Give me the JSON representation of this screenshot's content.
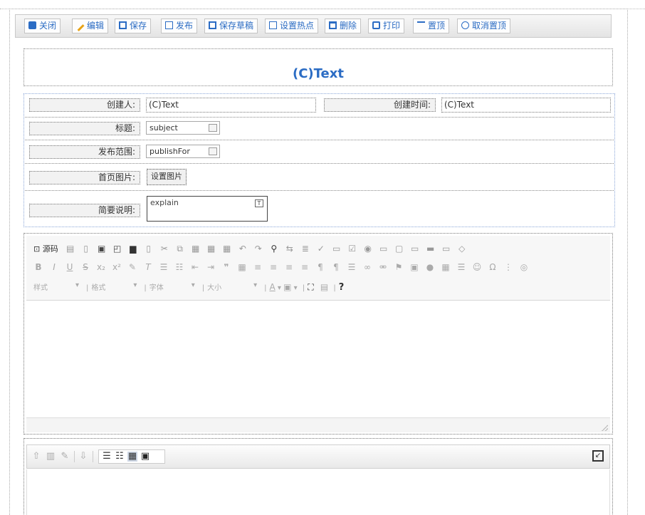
{
  "toolbar": {
    "buttons": [
      {
        "label": "关闭",
        "icon": "close-icon",
        "color": "#2b6cc4"
      },
      {
        "label": "编辑",
        "icon": "pencil-icon",
        "color": "#e8a317"
      },
      {
        "label": "保存",
        "icon": "save-icon",
        "color": "#2b6cc4"
      },
      {
        "label": "发布",
        "icon": "publish-icon",
        "color": "#2b6cc4"
      },
      {
        "label": "保存草稿",
        "icon": "save-draft-icon",
        "color": "#2b6cc4"
      },
      {
        "label": "设置热点",
        "icon": "hotspot-icon",
        "color": "#2b6cc4"
      },
      {
        "label": "删除",
        "icon": "trash-icon",
        "color": "#2b6cc4"
      },
      {
        "label": "打印",
        "icon": "print-icon",
        "color": "#2b6cc4"
      },
      {
        "label": "置顶",
        "icon": "pin-top-icon",
        "color": "#2b6cc4"
      },
      {
        "label": "取消置顶",
        "icon": "unpin-icon",
        "color": "#2b6cc4"
      }
    ]
  },
  "page": {
    "title": "(C)Text",
    "accent": "#2b6cc4"
  },
  "form": {
    "creator_label": "创建人:",
    "creator_value": "(C)Text",
    "created_time_label": "创建时间:",
    "created_time_value": "(C)Text",
    "subject_label": "标题:",
    "subject_value": "subject",
    "publish_label": "发布范围:",
    "publish_value": "publishFor",
    "image_label": "首页图片:",
    "image_button": "设置图片",
    "explain_label": "简要说明:",
    "explain_value": "explain"
  },
  "editor": {
    "source_label": "源码",
    "row3": {
      "style_label": "样式",
      "format_label": "格式",
      "font_label": "字体",
      "size_label": "大小",
      "help_label": "?"
    }
  }
}
